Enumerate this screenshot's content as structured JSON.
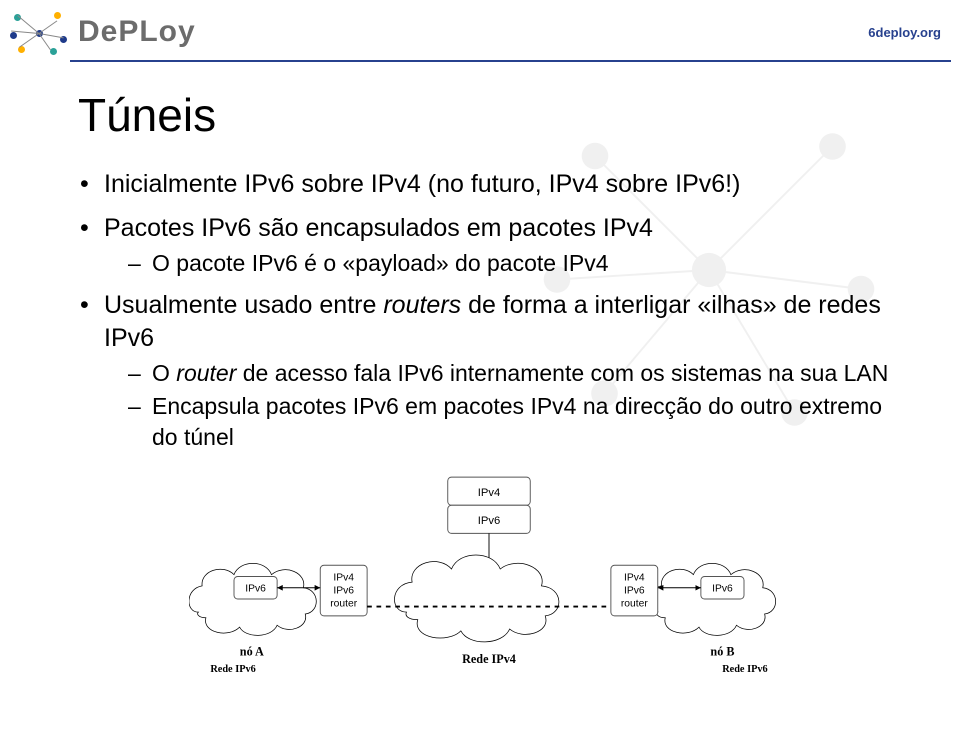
{
  "header": {
    "brand": "DePLoy",
    "url": "6deploy.org"
  },
  "title": "Túneis",
  "bullets": [
    {
      "text_parts": [
        "Inicialmente IPv6 sobre IPv4 (no futuro, IPv4 sobre IPv6!)"
      ]
    },
    {
      "text_parts": [
        "Pacotes IPv6 são encapsulados em pacotes IPv4"
      ],
      "sub": [
        {
          "text_parts": [
            "O pacote IPv6 é o «payload» do pacote IPv4"
          ]
        }
      ]
    },
    {
      "text_parts": [
        "Usualmente usado entre ",
        [
          "italic",
          "routers"
        ],
        " de forma a interligar «ilhas» de redes IPv6"
      ],
      "sub": [
        {
          "text_parts": [
            "O ",
            [
              "italic",
              "router"
            ],
            " de acesso fala IPv6 internamente com os sistemas na sua LAN"
          ]
        },
        {
          "text_parts": [
            "Encapsula pacotes IPv6 em pacotes IPv4 na direcção do outro extremo do túnel"
          ]
        }
      ]
    }
  ],
  "diagram": {
    "encap_top": "IPv4",
    "encap_bottom": "IPv6",
    "left_node": "IPv6",
    "left_router_top": "IPv4",
    "left_router_mid": "IPv6",
    "left_router_bot": "router",
    "right_router_top": "IPv4",
    "right_router_mid": "IPv6",
    "right_router_bot": "router",
    "right_node": "IPv6",
    "cloud_left_label_top": "nó A",
    "cloud_left_label_bot": "Rede IPv6",
    "cloud_center_label": "Rede IPv4",
    "cloud_right_label_top": "nó B",
    "cloud_right_label_bot": "Rede IPv6"
  }
}
